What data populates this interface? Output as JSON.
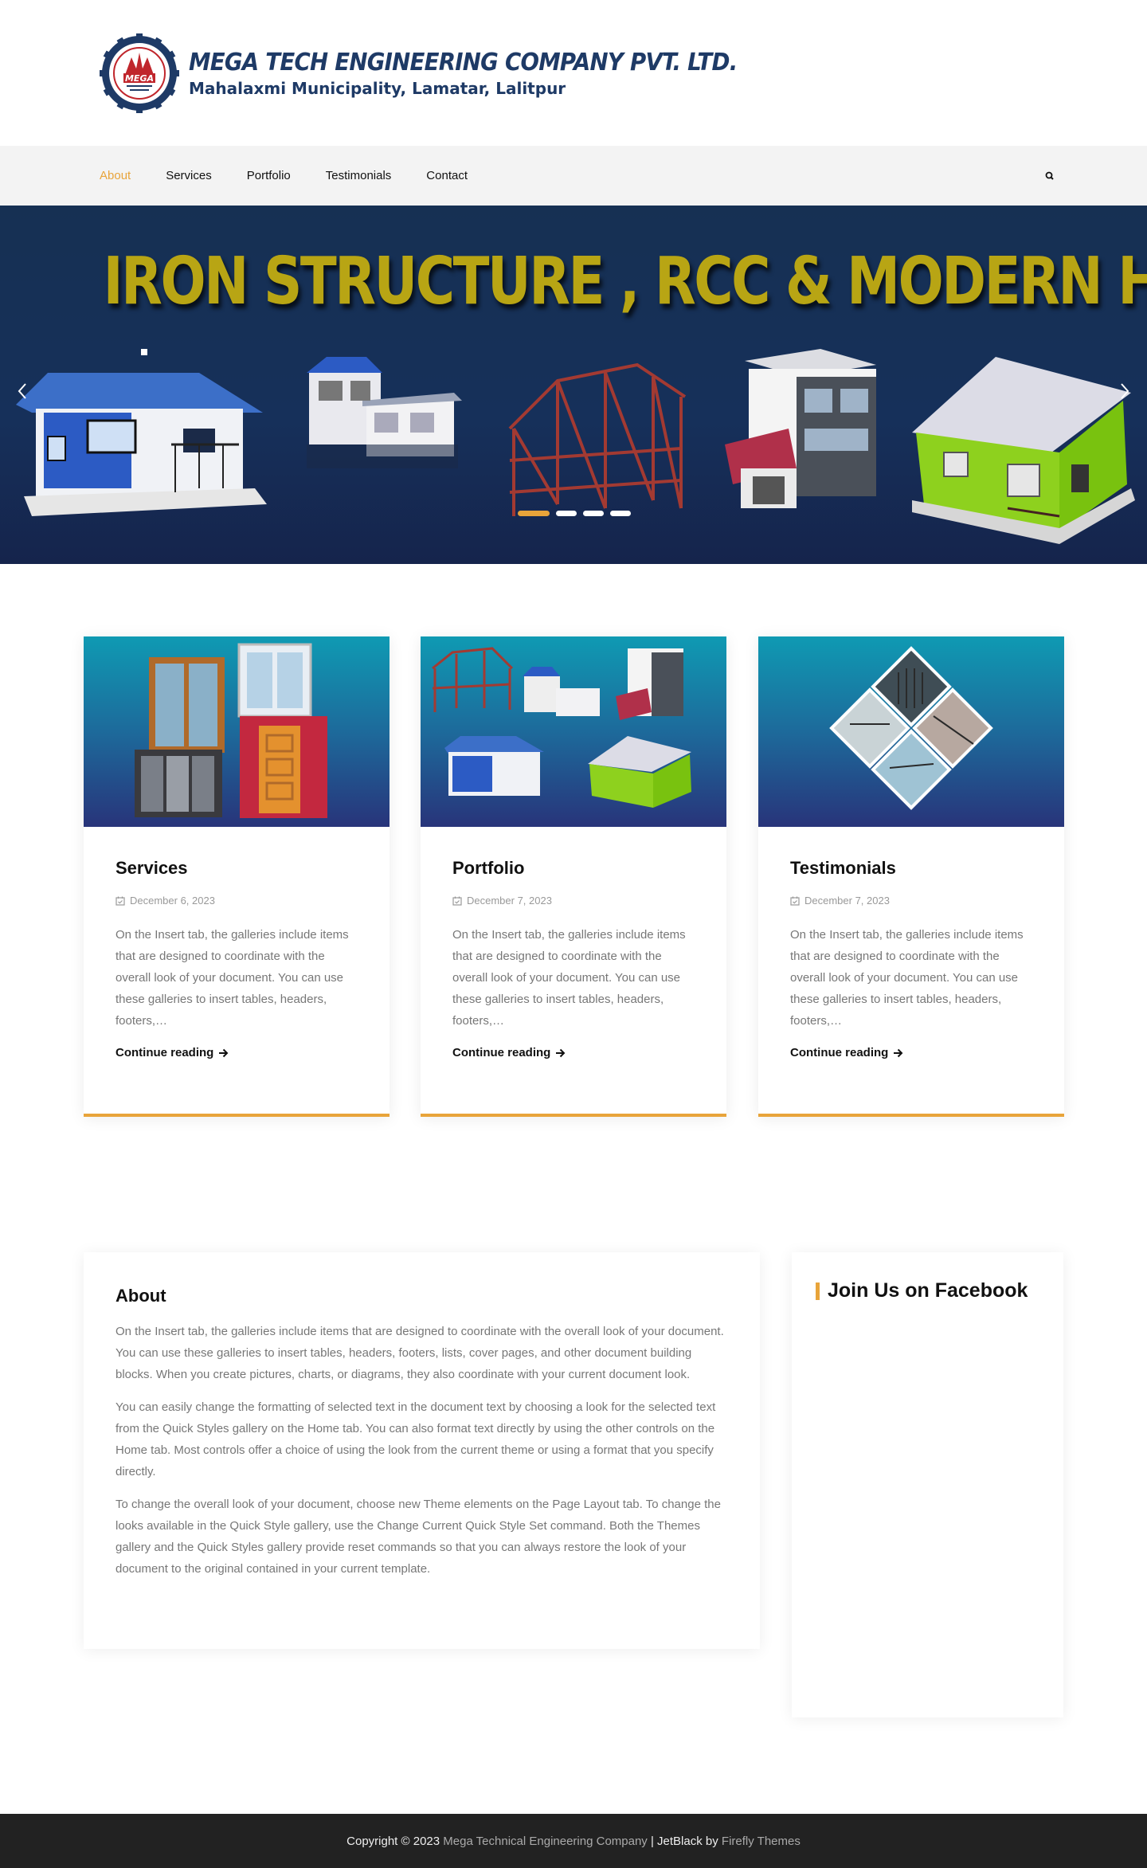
{
  "header": {
    "logo_title": "MEGA TECH ENGINEERING COMPANY PVT. LTD.",
    "logo_subtitle": "Mahalaxmi Municipality, Lamatar, Lalitpur",
    "emblem_text": "MEGA",
    "brand_colors": {
      "navy": "#1e3a66",
      "red": "#c0262c",
      "accent": "#e8a43a"
    }
  },
  "nav": {
    "items": [
      {
        "label": "About",
        "active": true
      },
      {
        "label": "Services",
        "active": false
      },
      {
        "label": "Portfolio",
        "active": false
      },
      {
        "label": "Testimonials",
        "active": false
      },
      {
        "label": "Contact",
        "active": false
      }
    ],
    "search_icon": "search-icon"
  },
  "hero": {
    "headline": "IRON STRUCTURE , RCC & MODERN HOUSE",
    "slide_count": 4,
    "active_slide": 1
  },
  "cards": [
    {
      "title": "Services",
      "date": "December 6, 2023",
      "excerpt": "On the Insert tab, the galleries include items that are designed to coordinate with the overall look of your document. You can use these galleries to insert tables, headers, footers,…",
      "link": "Continue reading"
    },
    {
      "title": "Portfolio",
      "date": "December 7, 2023",
      "excerpt": "On the Insert tab, the galleries include items that are designed to coordinate with the overall look of your document. You can use these galleries to insert tables, headers, footers,…",
      "link": "Continue reading"
    },
    {
      "title": "Testimonials",
      "date": "December 7, 2023",
      "excerpt": "On the Insert tab, the galleries include items that are designed to coordinate with the overall look of your document. You can use these galleries to insert tables, headers, footers,…",
      "link": "Continue reading"
    }
  ],
  "about": {
    "title": "About",
    "paragraphs": [
      "On the Insert tab, the galleries include items that are designed to coordinate with the overall look of your document. You can use these galleries to insert tables, headers, footers, lists, cover pages, and other document building blocks. When you create pictures, charts, or diagrams, they also coordinate with your current document look.",
      "You can easily change the formatting of selected text in the document text by choosing a look for the selected text from the Quick Styles gallery on the Home tab. You can also format text directly by using the other controls on the Home tab. Most controls offer a choice of using the look from the current theme or using a format that you specify directly.",
      "To change the overall look of your document, choose new Theme elements on the Page Layout tab. To change the looks available in the Quick Style gallery, use the Change Current Quick Style Set command. Both the Themes gallery and the Quick Styles gallery provide reset commands so that you can always restore the look of your document to the original contained in your current template."
    ]
  },
  "facebook": {
    "title": "Join Us on Facebook"
  },
  "footer": {
    "prefix": "Copyright © 2023 ",
    "company": "Mega Technical Engineering Company",
    "middle": " | JetBlack by ",
    "theme": "Firefly Themes"
  }
}
